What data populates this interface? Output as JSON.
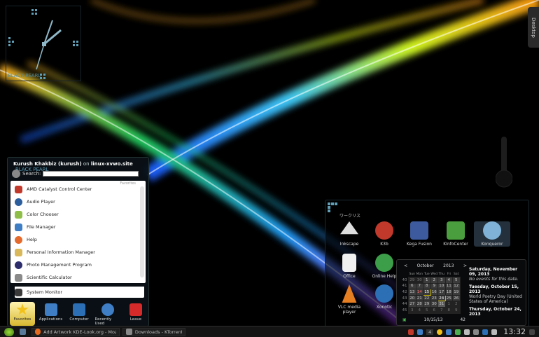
{
  "desktop": {
    "tab_label": "Desktop"
  },
  "clock_widget": {
    "label": "BLACK PEARL"
  },
  "menu": {
    "user_line_name": "Kurush Khakbiz (kurush)",
    "user_line_on": "on",
    "user_line_host": "linux-xvwo.site",
    "theme": "BLACK PEARL",
    "search_label": "Search:",
    "search_value": "",
    "favorites_label": "Favorites",
    "items": [
      {
        "label": "AMD Catalyst Control Center",
        "icon": "amd-icon",
        "color": "#c0392b"
      },
      {
        "label": "Audio Player",
        "icon": "audio-player-icon",
        "color": "#2c5e9e"
      },
      {
        "label": "Color Chooser",
        "icon": "color-chooser-icon",
        "color": "#8fbf4a"
      },
      {
        "label": "File Manager",
        "icon": "file-manager-icon",
        "color": "#3f7ec4"
      },
      {
        "label": "Help",
        "icon": "help-icon",
        "color": "#e46b2d"
      },
      {
        "label": "Personal Information Manager",
        "icon": "pim-icon",
        "color": "#d9b85b"
      },
      {
        "label": "Photo Management Program",
        "icon": "photo-icon",
        "color": "#2d2d6b"
      },
      {
        "label": "Scientific Calculator",
        "icon": "calculator-icon",
        "color": "#8a8a8a"
      },
      {
        "label": "System Monitor",
        "icon": "system-monitor-icon",
        "color": "#3a3a3a"
      }
    ],
    "tabs": [
      {
        "label": "Favorites",
        "icon": "star-icon",
        "color": "#f2c21b"
      },
      {
        "label": "Applications",
        "icon": "applications-icon",
        "color": "#3f7ec4"
      },
      {
        "label": "Computer",
        "icon": "computer-icon",
        "color": "#2d6fb5"
      },
      {
        "label": "Recently Used",
        "icon": "recent-icon",
        "color": "#3f7ec4"
      },
      {
        "label": "Leave",
        "icon": "leave-icon",
        "color": "#d42a2a"
      }
    ]
  },
  "folder_view": {
    "title": "ワークリス",
    "icons": [
      {
        "label": "Inkscape",
        "icon": "inkscape-icon",
        "color": "#ddd"
      },
      {
        "label": "K3b",
        "icon": "k3b-icon",
        "color": "#c0392b"
      },
      {
        "label": "Kega Fusion",
        "icon": "kega-fusion-icon",
        "color": "#3d5a9e"
      },
      {
        "label": "KInfoCenter",
        "icon": "kinfocenter-icon",
        "color": "#4a9e3d"
      },
      {
        "label": "Konqueror",
        "icon": "konqueror-icon",
        "color": "#7fb2d6"
      },
      {
        "label": "Office",
        "icon": "office-icon",
        "color": "#f0f0f0"
      },
      {
        "label": "Online Help",
        "icon": "online-help-icon",
        "color": "#3d9e4a"
      },
      {
        "label": "VLC media player",
        "icon": "vlc-icon",
        "color": "#e67e22"
      },
      {
        "label": "Xonotic",
        "icon": "xonotic-icon",
        "color": "#2d6fb5"
      }
    ]
  },
  "calendar": {
    "month": "October",
    "year": "2013",
    "headers": [
      "",
      "Sun",
      "Mon",
      "Tue",
      "Wed",
      "Thu",
      "Fri",
      "Sat"
    ],
    "rows": [
      [
        "40",
        "29",
        "30",
        "1",
        "2",
        "3",
        "4",
        "5"
      ],
      [
        "41",
        "6",
        "7",
        "8",
        "9",
        "10",
        "11",
        "12"
      ],
      [
        "42",
        "13",
        "14",
        "15",
        "16",
        "17",
        "18",
        "19"
      ],
      [
        "43",
        "20",
        "21",
        "22",
        "23",
        "24",
        "25",
        "26"
      ],
      [
        "44",
        "27",
        "28",
        "29",
        "30",
        "31",
        "1",
        "2"
      ],
      [
        "45",
        "3",
        "4",
        "5",
        "6",
        "7",
        "8",
        "9"
      ]
    ],
    "date_field": "10/15/13",
    "week_field": "42",
    "events": [
      {
        "date": "Saturday, November 09, 2013",
        "text": "No events for this date."
      },
      {
        "date": "Tuesday, October 15, 2013",
        "text": "World Poetry Day (United States of America)"
      },
      {
        "date": "Thursday, October 24, 2013",
        "text": ""
      }
    ]
  },
  "taskbar": {
    "tasks": [
      {
        "label": "Add  Artwork KDE-Look.org - Mozilla",
        "icon": "firefox-icon"
      },
      {
        "label": "Downloads - KTorrent",
        "icon": "ktorrent-icon"
      }
    ],
    "pager": "4",
    "time": "13:32"
  }
}
